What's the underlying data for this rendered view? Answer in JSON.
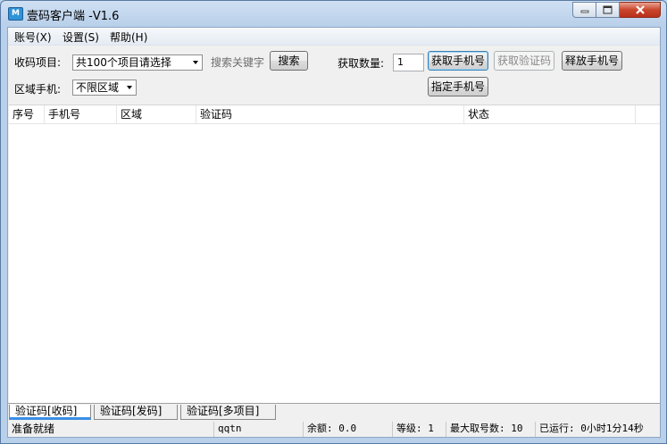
{
  "window": {
    "title": "壹码客户端 -V1.6",
    "icon_glyph": "M"
  },
  "menu": [
    "账号(X)",
    "设置(S)",
    "帮助(H)"
  ],
  "toolbar": {
    "project_label": "收码项目:",
    "project_value": "共100个项目请选择",
    "search_placeholder": "搜索关键字",
    "search_button": "搜索",
    "quantity_label": "获取数量:",
    "quantity_value": "1",
    "get_phone_button": "获取手机号",
    "get_code_button": "获取验证码",
    "release_phone_button": "释放手机号",
    "region_label": "区域手机:",
    "region_value": "不限区域",
    "assign_phone_button": "指定手机号"
  },
  "table": {
    "columns": [
      "序号",
      "手机号",
      "区域",
      "验证码",
      "状态"
    ],
    "rows": []
  },
  "tabs": [
    "验证码[收码]",
    "验证码[发码]",
    "验证码[多项目]"
  ],
  "status": {
    "state": "准备就绪",
    "user": "qqtn",
    "balance": "余额: 0.0",
    "level": "等级: 1",
    "max_numbers": "最大取号数: 10",
    "runtime": "已运行: 0小时1分14秒"
  },
  "colors": {
    "titlebar": "#cfe0f3",
    "close": "#c9462c",
    "active_tab_accent": "#3a8ee6"
  }
}
